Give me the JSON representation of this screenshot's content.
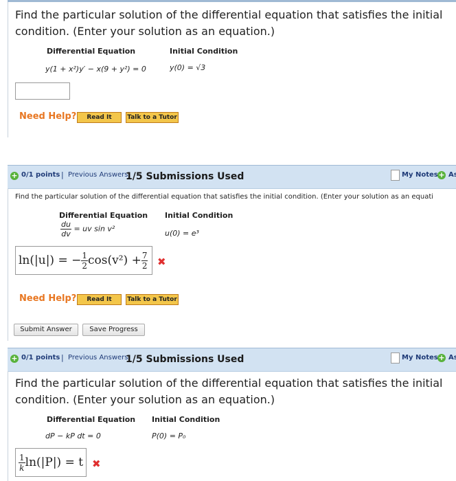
{
  "q1": {
    "prompt_line1": "Find the particular solution of the differential equation that satisfies the initial",
    "prompt_line2": "condition. (Enter your solution as an equation.)",
    "header_de": "Differential Equation",
    "header_ic": "Initial Condition",
    "de": "y(1 + x²)y′ − x(9 + y²) = 0",
    "ic": "y(0) = √3",
    "answer_value": ""
  },
  "help": {
    "label": "Need Help?",
    "read_it": "Read It",
    "tutor": "Talk to a Tutor"
  },
  "bar": {
    "points": "0/1 points",
    "separator": "|",
    "previous": "Previous Answers",
    "submissions": "1/5 Submissions Used",
    "my_notes": "My Notes",
    "ask": "Ask"
  },
  "q2": {
    "prompt": "Find the particular solution of the differential equation that satisfies the initial condition. (Enter your solution as an equati",
    "header_de": "Differential Equation",
    "header_ic": "Initial Condition",
    "de_num": "du",
    "de_den": "dv",
    "de_rhs": "= uv sin v²",
    "ic": "u(0) = e³",
    "answer": {
      "lhs": "ln(|u|) = −",
      "f1_num": "1",
      "f1_den": "2",
      "mid": "cos(v²) +",
      "f2_num": "7",
      "f2_den": "2"
    },
    "submit": "Submit Answer",
    "save": "Save Progress"
  },
  "q3": {
    "prompt_line1": "Find the particular solution of the differential equation that satisfies the initial",
    "prompt_line2": "condition. (Enter your solution as an equation.)",
    "header_de": "Differential Equation",
    "header_ic": "Initial Condition",
    "de": "dP − kP dt = 0",
    "ic": "P(0) = P₀",
    "answer": {
      "f_num": "1",
      "f_den": "k",
      "rest": "ln(|P|) = t"
    }
  },
  "colors": {
    "bar_bg": "#d2e2f2",
    "help_orange": "#e87722",
    "wrong_red": "#e03030",
    "button_yellow": "#f3c64a"
  },
  "icons": [
    "plus-circle-icon",
    "notes-page-icon",
    "x-mark-icon"
  ],
  "wrong_mark": "✖"
}
